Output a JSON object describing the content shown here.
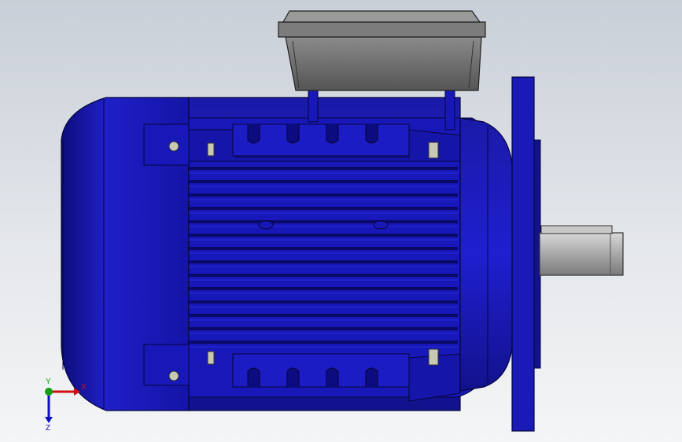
{
  "viewport": {
    "background_top": "#c9cfd8",
    "background_bottom": "#f4f5f6"
  },
  "model": {
    "part": "motor-assembly",
    "body_color": "#1414b4",
    "body_dark": "#0a0a6e",
    "body_light": "#2b2be0",
    "terminal_box_color": "#6b6b6b",
    "shaft_color": "#a8a8a8"
  },
  "triad": {
    "x_label": "X",
    "y_label": "Y",
    "z_label": "Z",
    "x_color": "#d01010",
    "y_color": "#10a010",
    "z_color": "#1010c0"
  }
}
